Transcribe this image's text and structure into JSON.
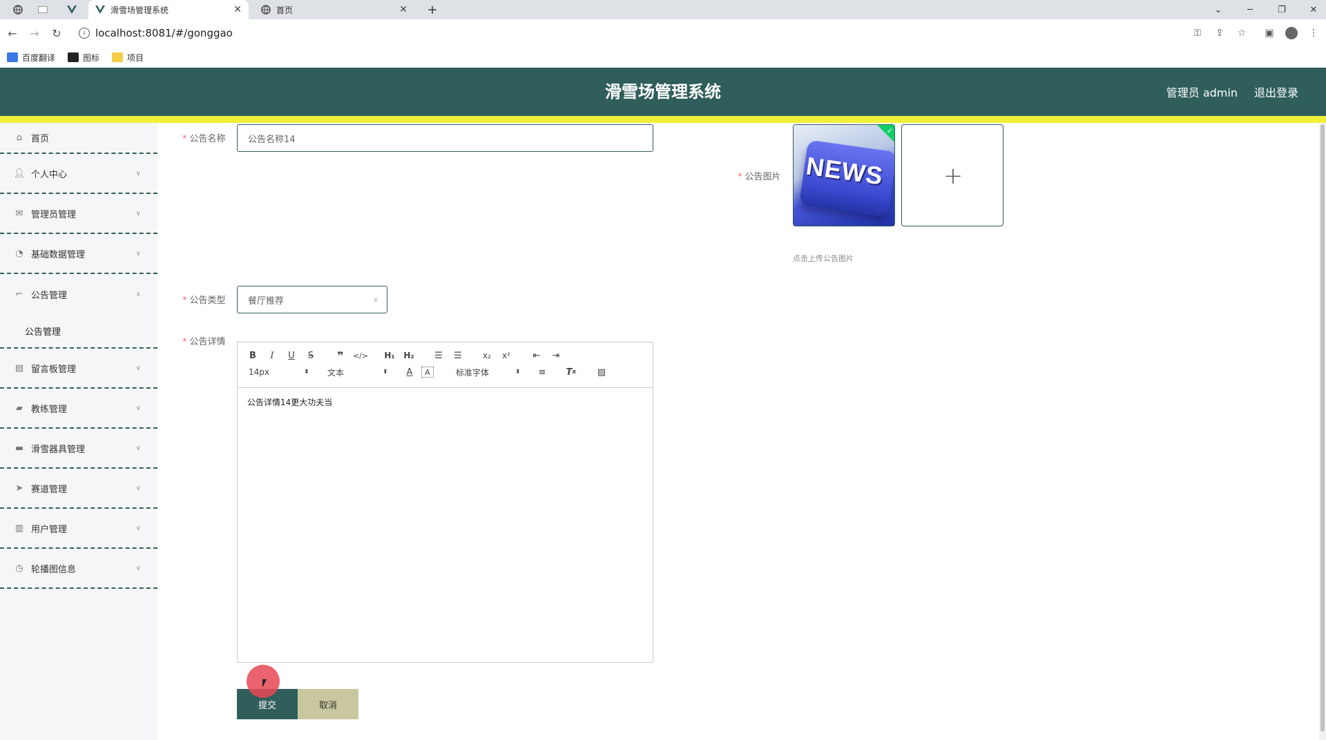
{
  "browser": {
    "tabs": [
      {
        "title": "滑雪场管理系统",
        "active": true
      },
      {
        "title": "首页",
        "active": false
      }
    ],
    "new_tab_label": "+",
    "url": "localhost:8081/#/gonggao",
    "bookmarks": [
      {
        "label": "百度翻译"
      },
      {
        "label": "图标"
      },
      {
        "label": "项目"
      }
    ]
  },
  "header": {
    "title": "滑雪场管理系统",
    "user_label": "管理员 admin",
    "logout_label": "退出登录",
    "bg_color": "#2f5e5b",
    "accent_color": "#f0f03a"
  },
  "sidebar": {
    "items": [
      {
        "label": "首页",
        "icon": "home-icon"
      },
      {
        "label": "个人中心",
        "icon": "user-icon"
      },
      {
        "label": "管理员管理",
        "icon": "mail-icon"
      },
      {
        "label": "基础数据管理",
        "icon": "compass-icon"
      },
      {
        "label": "公告管理",
        "icon": "crop-icon",
        "expanded": true,
        "sub": [
          "公告管理"
        ]
      },
      {
        "label": "留言板管理",
        "icon": "bank-icon"
      },
      {
        "label": "教练管理",
        "icon": "ticket-icon"
      },
      {
        "label": "滑雪器具管理",
        "icon": "monitor-icon"
      },
      {
        "label": "赛道管理",
        "icon": "send-icon"
      },
      {
        "label": "用户管理",
        "icon": "clipboard-icon"
      },
      {
        "label": "轮播图信息",
        "icon": "clock-icon"
      }
    ]
  },
  "form": {
    "name_label": "公告名称",
    "name_value": "公告名称14",
    "image_label": "公告图片",
    "image_hint": "点击上传公告图片",
    "news_text": "NEWS",
    "plus_label": "+",
    "type_label": "公告类型",
    "type_value": "餐厅推荐",
    "detail_label": "公告详情",
    "detail_value": "公告详情14更大功夫当",
    "toolbar": {
      "size": "14px",
      "header": "文本",
      "font": "标准字体"
    },
    "submit_label": "提交",
    "cancel_label": "取消"
  }
}
